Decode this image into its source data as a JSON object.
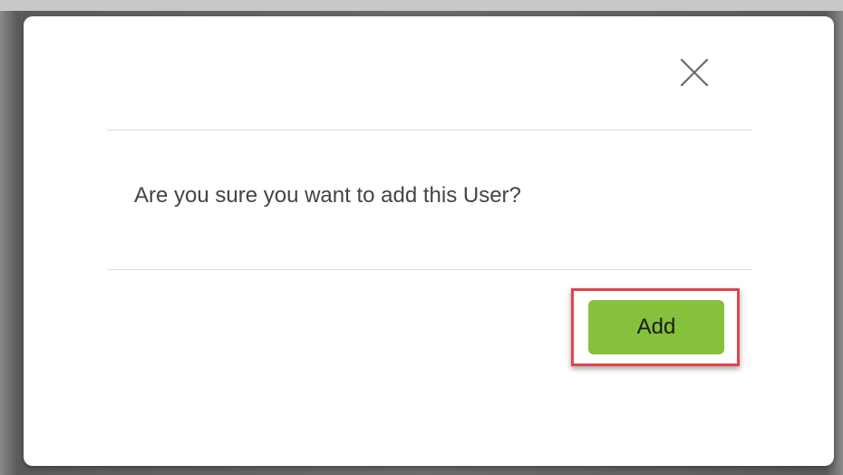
{
  "dialog": {
    "message": "Are you sure you want to add this User?",
    "close_icon": "close-icon",
    "add_label": "Add"
  },
  "colors": {
    "add_button_bg": "#85c13b",
    "highlight_border": "#e0454b",
    "backdrop": "#6b6b6b",
    "message_text": "#444444"
  }
}
